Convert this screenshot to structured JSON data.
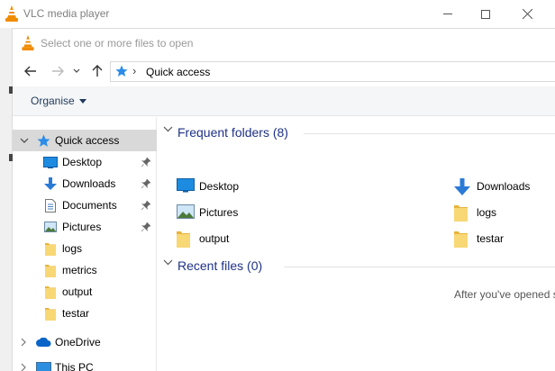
{
  "vlc_window": {
    "title": "VLC media player",
    "controls": {
      "minimize": "—",
      "maximize": "☐",
      "close": "✕"
    }
  },
  "dialog": {
    "title": "Select one or more files to open",
    "address": {
      "path": "Quick access"
    },
    "command_bar": {
      "organise_label": "Organise"
    },
    "nav_pane": {
      "items": [
        {
          "label": "Quick access",
          "icon": "star-icon",
          "selected": true
        },
        {
          "label": "Desktop",
          "icon": "desktop-icon",
          "pinned": true
        },
        {
          "label": "Downloads",
          "icon": "download-icon",
          "pinned": true
        },
        {
          "label": "Documents",
          "icon": "documents-icon",
          "pinned": true
        },
        {
          "label": "Pictures",
          "icon": "pictures-icon",
          "pinned": true
        },
        {
          "label": "logs",
          "icon": "folder-icon"
        },
        {
          "label": "metrics",
          "icon": "folder-icon"
        },
        {
          "label": "output",
          "icon": "folder-icon"
        },
        {
          "label": "testar",
          "icon": "folder-icon"
        },
        {
          "label": "OneDrive",
          "icon": "cloud-icon"
        },
        {
          "label": "This PC",
          "icon": "computer-icon"
        }
      ]
    },
    "content": {
      "frequent_folders": {
        "heading": "Frequent folders (8)",
        "items": [
          {
            "label": "Desktop",
            "icon": "desktop-icon"
          },
          {
            "label": "Downloads",
            "icon": "download-icon"
          },
          {
            "label": "Pictures",
            "icon": "pictures-icon"
          },
          {
            "label": "logs",
            "icon": "folder-icon"
          },
          {
            "label": "output",
            "icon": "folder-icon"
          },
          {
            "label": "testar",
            "icon": "folder-icon"
          }
        ]
      },
      "recent_files": {
        "heading": "Recent files (0)",
        "empty_message": "After you've opened s"
      }
    }
  },
  "colors": {
    "selection": "#d9d9d9",
    "heading_blue": "#1e3287",
    "folder_yellow": "#f8d775",
    "vlc_orange": "#f08c00"
  }
}
